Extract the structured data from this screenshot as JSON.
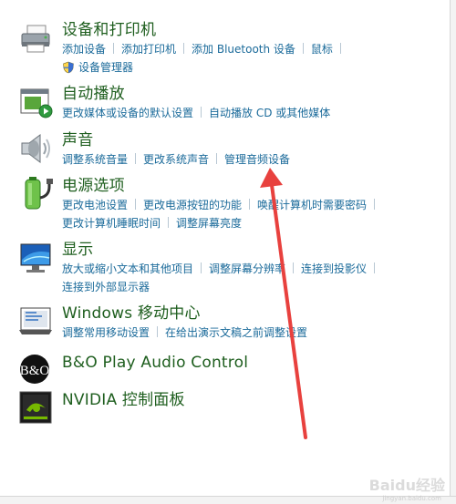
{
  "categories": [
    {
      "title": "设备和打印机",
      "icon": "printer-icon",
      "rows": [
        [
          "添加设备",
          "添加打印机",
          "添加 Bluetooth 设备",
          "鼠标"
        ],
        [
          "设备管理器"
        ]
      ]
    },
    {
      "title": "自动播放",
      "icon": "autoplay-icon",
      "rows": [
        [
          "更改媒体或设备的默认设置",
          "自动播放 CD 或其他媒体"
        ]
      ]
    },
    {
      "title": "声音",
      "icon": "speaker-icon",
      "rows": [
        [
          "调整系统音量",
          "更改系统声音",
          "管理音频设备"
        ]
      ]
    },
    {
      "title": "电源选项",
      "icon": "battery-icon",
      "rows": [
        [
          "更改电池设置",
          "更改电源按钮的功能",
          "唤醒计算机时需要密码"
        ],
        [
          "更改计算机睡眠时间",
          "调整屏幕亮度"
        ]
      ]
    },
    {
      "title": "显示",
      "icon": "display-icon",
      "rows": [
        [
          "放大或缩小文本和其他项目",
          "调整屏幕分辨率",
          "连接到投影仪"
        ],
        [
          "连接到外部显示器"
        ]
      ]
    },
    {
      "title": "Windows 移动中心",
      "icon": "mobility-center-icon",
      "rows": [
        [
          "调整常用移动设置",
          "在给出演示文稿之前调整设置"
        ]
      ]
    },
    {
      "title": "B&O Play Audio Control",
      "icon": "bang-olufsen-icon",
      "rows": []
    },
    {
      "title": "NVIDIA 控制面板",
      "icon": "nvidia-icon",
      "rows": []
    }
  ],
  "watermark": {
    "logo": "Baidu经验",
    "sub": "jingyan.baidu.com"
  },
  "colors": {
    "title": "#1e5e1e",
    "link": "#1a6a9a",
    "arrow": "#e8413e"
  }
}
